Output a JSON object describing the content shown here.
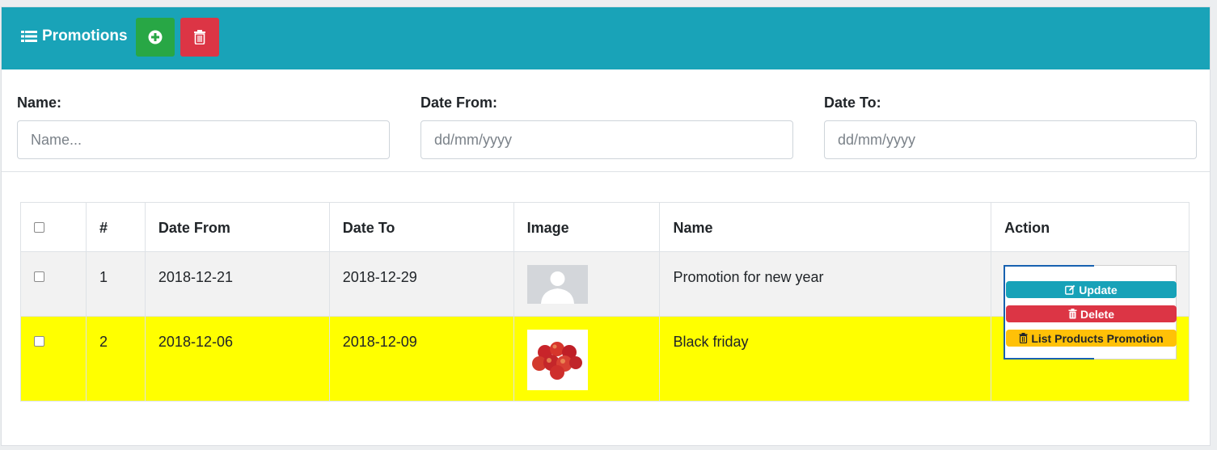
{
  "header": {
    "title": "Promotions",
    "add_icon": "plus-circle-icon",
    "delete_icon": "trash-icon",
    "colors": {
      "header_bg": "#19a3b8",
      "add_btn": "#28a745",
      "delete_btn": "#dc3545"
    }
  },
  "filters": {
    "name": {
      "label": "Name:",
      "placeholder": "Name..."
    },
    "date_from": {
      "label": "Date From:",
      "placeholder": "dd/mm/yyyy"
    },
    "date_to": {
      "label": "Date To:",
      "placeholder": "dd/mm/yyyy"
    }
  },
  "table": {
    "columns": [
      "#",
      "Date From",
      "Date To",
      "Image",
      "Name",
      "Action"
    ],
    "rows": [
      {
        "index": "1",
        "date_from": "2018-12-21",
        "date_to": "2018-12-29",
        "image": "avatar-placeholder",
        "name": "Promotion for new year"
      },
      {
        "index": "2",
        "date_from": "2018-12-06",
        "date_to": "2018-12-09",
        "image": "apples-photo",
        "name": "Black friday"
      }
    ],
    "highlight_color": "#ffff00"
  },
  "actions_menu": {
    "update": "Update",
    "delete": "Delete",
    "list_products": "List Products Promotion"
  }
}
